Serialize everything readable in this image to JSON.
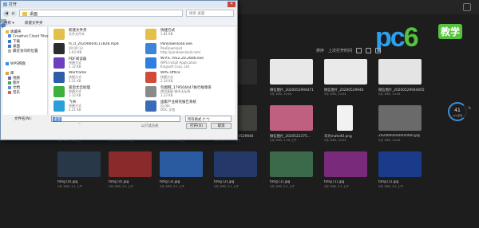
{
  "dialog": {
    "title": "打开",
    "address": "桌面",
    "search_placeholder": "搜索 桌面",
    "toolbar": {
      "organize": "组织 ▾",
      "new_folder": "新建文件夹"
    },
    "sidebar": [
      {
        "label": "收藏夹"
      },
      {
        "label": "Creative Cloud Files"
      },
      {
        "label": "下载"
      },
      {
        "label": "桌面"
      },
      {
        "label": "最近访问的位置"
      },
      {
        "label": "WPS网盘"
      },
      {
        "label": "库"
      },
      {
        "label": "视频"
      },
      {
        "label": "图片"
      },
      {
        "label": "文档"
      },
      {
        "label": "音乐"
      }
    ],
    "items": [
      {
        "name": "新建文件夹",
        "l2": "文件文件夹",
        "l3": ""
      },
      {
        "name": "快捷方式",
        "l2": "1.81 KB",
        "l3": ""
      },
      {
        "name": "fs_0_20200604111828.mp4",
        "l2": "00:00:13",
        "l3": "3.63 MB"
      },
      {
        "name": "PanDownload.exe",
        "l2": "PanDownload",
        "l3": "http://pandownload.com/"
      },
      {
        "name": "PDF阅读器",
        "l2": "快捷方式",
        "l3": "1.12 KB"
      },
      {
        "name": "W.P.S.7912.20.2666.exe",
        "l2": "WPS Install Application",
        "l3": "Kingsoft Corp. Ltd."
      },
      {
        "name": "Warframe",
        "l2": "快捷方式",
        "l3": "2.21 KB"
      },
      {
        "name": "WPS Office",
        "l2": "快捷方式",
        "l3": "2.24 KB"
      },
      {
        "name": "爱思尤云助理",
        "l2": "快捷方式",
        "l3": "1.12 KB"
      },
      {
        "name": "包图网_179504447执行规章系",
        "l2": "使用基础 城市天际线",
        "l3": "1.22 KB"
      },
      {
        "name": "飞书",
        "l2": "快捷方式",
        "l3": "2.21 KB"
      },
      {
        "name": "国家产业研究报告系统",
        "l2": "出.doc",
        "l3": "DOC 文档"
      }
    ],
    "footer": {
      "filename_label": "文件名(N):",
      "filename_value": "桌面",
      "filetype": "所有格式 (*.*)",
      "readonly": "以只读方式",
      "open": "打开(O)",
      "cancel": "取消"
    }
  },
  "background": {
    "sort_label": "排序",
    "sort_value": "上次打开时间",
    "gauge_value": "41",
    "gauge_unit": "%",
    "gauge_sub": "CPU使用",
    "rows": [
      [
        {
          "cap": "",
          "sub": ""
        },
        {
          "cap": "",
          "sub": ""
        },
        {
          "cap": "",
          "sub": ""
        },
        {
          "cap": "",
          "sub": ""
        },
        {
          "cap": "微信图片_2020052994471",
          "sub": "3月 1MB, 10:04"
        },
        {
          "cap": "微信图片_20200529944",
          "sub": "5月 1MB, 10:04"
        },
        {
          "cap": "微信图片_20200529944005",
          "sub": "5月 1MB, 10:04"
        }
      ],
      [
        {
          "cap": "微信图片_202005029940",
          "sub": "5月 1MB, 1:1 上午"
        },
        {
          "cap": "微信图片_202005294322",
          "sub": "5月 1MB, 2:16 上午"
        },
        {
          "cap": "微信图片_20200529940",
          "sub": "5月 1MB, 2:16 上午"
        },
        {
          "cap": "微信图片_20200529940",
          "sub": "5月 1MB, 2:16 上午"
        },
        {
          "cap": "微信图片_2020522375...",
          "sub": "5月 1MB, 2:16 上午"
        },
        {
          "cap": "华为mate40.png",
          "sub": "5月 1MB, 10:04"
        },
        {
          "cap": "2020060440005060.jpg",
          "sub": "5月 1MB, 10:04"
        }
      ],
      [
        {
          "cap": "timg (4).jpg",
          "sub": "5月 1MB, 3:1 上午"
        },
        {
          "cap": "timg (4).jpg",
          "sub": "5月 1MB, 3:1 上午"
        },
        {
          "cap": "timg (3).jpg",
          "sub": "5月 1MB, 3:1 上午"
        },
        {
          "cap": "timg (2).jpg",
          "sub": "5月 1MB, 3:1 上午"
        },
        {
          "cap": "timg (1).jpg",
          "sub": "5月 1MB, 3:1 上午"
        },
        {
          "cap": "timg (1).jpg",
          "sub": "5月 1MB, 3:1 上午"
        },
        {
          "cap": "timg (1).jpg",
          "sub": "5月 1MB, 3:1 上午"
        }
      ]
    ]
  },
  "brand": {
    "logo_text": "pc6",
    "logo_badge": "教学"
  }
}
